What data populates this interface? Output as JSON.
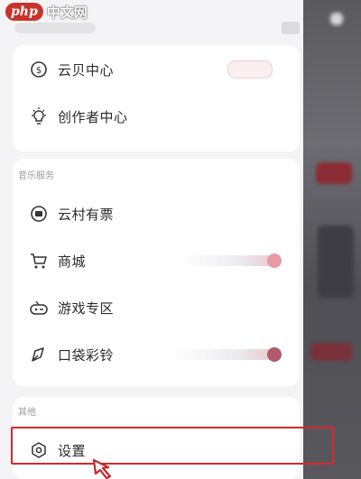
{
  "watermark": {
    "logo": "php",
    "text": "中文网"
  },
  "drawer": {
    "section1": {
      "items": [
        {
          "label": "云贝中心",
          "icon": "coin-icon"
        },
        {
          "label": "创作者中心",
          "icon": "lightbulb-icon"
        }
      ]
    },
    "section2": {
      "title": "音乐服务",
      "items": [
        {
          "label": "云村有票",
          "icon": "ticket-icon"
        },
        {
          "label": "商城",
          "icon": "cart-icon"
        },
        {
          "label": "游戏专区",
          "icon": "gamepad-icon"
        },
        {
          "label": "口袋彩铃",
          "icon": "ringtone-icon"
        }
      ]
    },
    "section3": {
      "title": "其他",
      "items": [
        {
          "label": "设置",
          "icon": "settings-icon",
          "highlighted": true
        }
      ]
    }
  },
  "colors": {
    "highlight": "#d9262b",
    "accent": "#e79aa2"
  }
}
